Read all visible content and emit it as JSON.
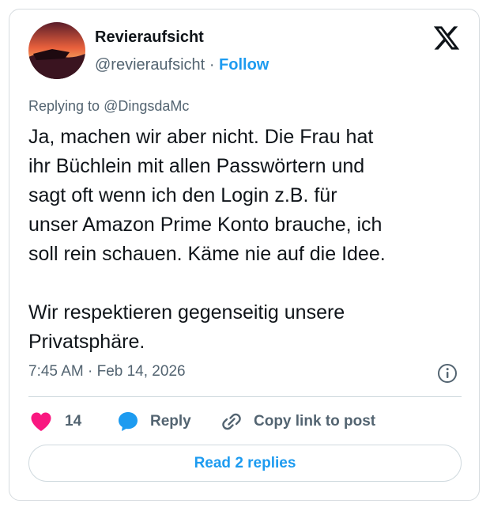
{
  "author": {
    "name": "Revieraufsicht",
    "handle": "@revieraufsicht",
    "separator": "·",
    "follow_label": "Follow"
  },
  "reply_context": {
    "prefix": "Replying to ",
    "mention": "@DingsdaMc"
  },
  "tweet": {
    "text": "Ja, machen wir aber nicht. Die Frau hat\nihr Büchlein mit allen Passwörtern und\nsagt oft wenn ich den Login z.B. für\nunser Amazon Prime Konto brauche, ich\nsoll rein schauen. Käme nie auf die Idee.\n\nWir respektieren gegenseitig unsere\nPrivatsphäre.",
    "timestamp": "7:45 AM · Feb 14, 2026"
  },
  "actions": {
    "like_count": "14",
    "reply_label": "Reply",
    "copy_label": "Copy link to post"
  },
  "footer": {
    "read_replies_label": "Read 2 replies"
  },
  "icons": {
    "logo": "x-logo-icon",
    "info": "info-icon",
    "like": "heart-icon",
    "reply": "speech-bubble-icon",
    "copy": "link-icon"
  },
  "colors": {
    "accent": "#1d9bf0",
    "like": "#f91880",
    "text": "#0f1419",
    "secondary": "#536471"
  }
}
